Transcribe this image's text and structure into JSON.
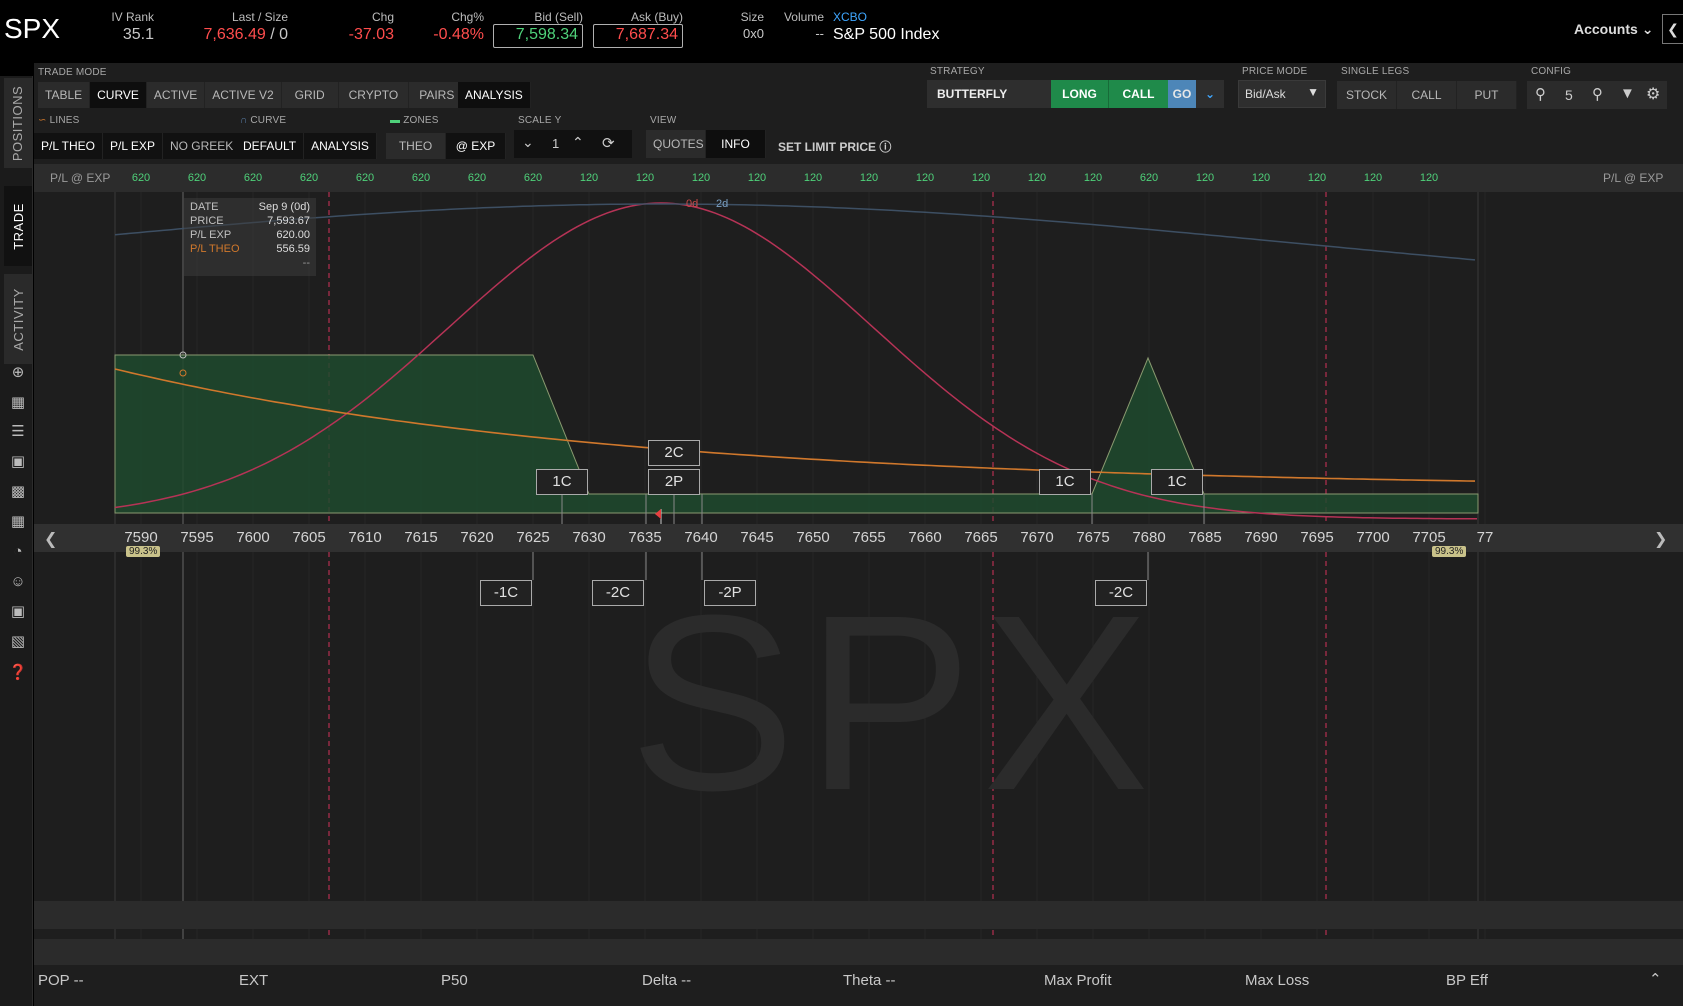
{
  "quote": {
    "symbol": "SPX",
    "iv_rank_label": "IV Rank",
    "iv_rank": "35.1",
    "last_label": "Last / Size",
    "last": "7,636.49",
    "last_size": "/ 0",
    "chg_label": "Chg",
    "chg": "-37.03",
    "chgpct_label": "Chg%",
    "chgpct": "-0.48%",
    "bid_label": "Bid (Sell)",
    "bid": "7,598.34",
    "ask_label": "Ask (Buy)",
    "ask": "7,687.34",
    "size_label": "Size",
    "size": "0x0",
    "volume_label": "Volume",
    "volume": "--",
    "exchange": "XCBO",
    "name": "S&P 500 Index",
    "accounts": "Accounts"
  },
  "sidebar": {
    "tabs": [
      "POSITIONS",
      "TRADE",
      "ACTIVITY"
    ],
    "icons": [
      "crosshair-icon",
      "report-icon",
      "list-icon",
      "tv-icon",
      "calendar-grid-icon",
      "dashboard-icon",
      "gauge-icon",
      "people-icon",
      "calendar-icon",
      "stats-icon",
      "help-icon"
    ]
  },
  "trade_mode": {
    "label": "TRADE MODE",
    "tabs": [
      "TABLE",
      "CURVE",
      "ACTIVE",
      "ACTIVE V2",
      "GRID",
      "CRYPTO",
      "PAIRS"
    ],
    "analysis": "ANALYSIS"
  },
  "strategy": {
    "label": "STRATEGY",
    "name": "BUTTERFLY",
    "side": "LONG",
    "type": "CALL",
    "go": "GO"
  },
  "price_mode": {
    "label": "PRICE MODE",
    "value": "Bid/Ask"
  },
  "single_legs": {
    "label": "SINGLE LEGS",
    "items": [
      "STOCK",
      "CALL",
      "PUT"
    ]
  },
  "config": {
    "label": "CONFIG",
    "zoom": "5"
  },
  "lines": {
    "label": "LINES",
    "items": [
      "P/L THEO",
      "P/L EXP"
    ],
    "greek": "NO GREEK"
  },
  "curve": {
    "label": "CURVE",
    "items": [
      "DEFAULT",
      "ANALYSIS"
    ]
  },
  "zones": {
    "label": "ZONES",
    "items": [
      "THEO",
      "@ EXP"
    ]
  },
  "scale_y": {
    "label": "SCALE Y",
    "value": "1"
  },
  "view": {
    "label": "VIEW",
    "items": [
      "QUOTES",
      "INFO"
    ],
    "set_limit": "SET LIMIT PRICE"
  },
  "pl_strip": {
    "label": "P/L @ EXP",
    "values": [
      "620",
      "620",
      "620",
      "620",
      "620",
      "620",
      "620",
      "620",
      "120",
      "120",
      "120",
      "120",
      "120",
      "120",
      "120",
      "120",
      "120",
      "120",
      "620",
      "120",
      "120",
      "120",
      "120",
      "120"
    ]
  },
  "axis": {
    "ticks": [
      "7590",
      "7595",
      "7600",
      "7605",
      "7610",
      "7615",
      "7620",
      "7625",
      "7630",
      "7635",
      "7640",
      "7645",
      "7650",
      "7655",
      "7660",
      "7665",
      "7670",
      "7675",
      "7680",
      "7685",
      "7690",
      "7695",
      "7700",
      "7705",
      "77"
    ],
    "left_pct": "99.3%",
    "right_pct": "99.3%"
  },
  "day_labels": [
    "0d",
    "2d"
  ],
  "tooltip": {
    "date_label": "DATE",
    "date": "Sep 9 (0d)",
    "price_label": "PRICE",
    "price": "7,593.67",
    "plexp_label": "P/L EXP",
    "plexp": "620.00",
    "pltheo_label": "P/L THEO",
    "pltheo": "556.59",
    "extra": "--"
  },
  "legs_above": [
    "1C",
    "2C",
    "2P",
    "1C",
    "1C"
  ],
  "legs_below": [
    "-1C",
    "-2C",
    "-2P",
    "-2C"
  ],
  "watermark": "SPX",
  "footer": {
    "pop": "POP --",
    "ext": "EXT",
    "p50": "P50",
    "delta": "Delta --",
    "theta": "Theta --",
    "max_profit": "Max Profit",
    "max_loss": "Max Loss",
    "bp_eff": "BP Eff"
  },
  "colors": {
    "profit_zone": "#1f4a2e",
    "theo_line": "#d0782c",
    "prob_curve": "#b63356",
    "accent_green": "#1f8a4a"
  }
}
